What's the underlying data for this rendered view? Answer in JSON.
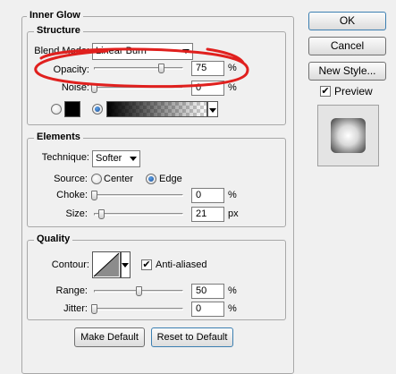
{
  "title": "Inner Glow",
  "structure": {
    "legend": "Structure",
    "blend_mode_label": "Blend Mode:",
    "blend_mode_value": "Linear Burn",
    "opacity_label": "Opacity:",
    "opacity_value": "75",
    "opacity_unit": "%",
    "opacity_level": 0.75,
    "noise_label": "Noise:",
    "noise_value": "0",
    "noise_unit": "%",
    "noise_level": 0,
    "glow_color": "#000000",
    "color_option_selected": "gradient"
  },
  "elements": {
    "legend": "Elements",
    "technique_label": "Technique:",
    "technique_value": "Softer",
    "source_label": "Source:",
    "source_center_label": "Center",
    "source_edge_label": "Edge",
    "source_selected": "Edge",
    "choke_label": "Choke:",
    "choke_value": "0",
    "choke_unit": "%",
    "choke_level": 0,
    "size_label": "Size:",
    "size_value": "21",
    "size_unit": "px",
    "size_level": 0.084
  },
  "quality": {
    "legend": "Quality",
    "contour_label": "Contour:",
    "antialiased_label": "Anti-aliased",
    "antialiased_checked": true,
    "range_label": "Range:",
    "range_value": "50",
    "range_unit": "%",
    "range_level": 0.5,
    "jitter_label": "Jitter:",
    "jitter_value": "0",
    "jitter_unit": "%",
    "jitter_level": 0
  },
  "buttons": {
    "make_default": "Make Default",
    "reset_default": "Reset to Default",
    "ok": "OK",
    "cancel": "Cancel",
    "new_style": "New Style..."
  },
  "preview": {
    "label": "Preview",
    "checked": true
  },
  "annotation_color": "#e0201e"
}
